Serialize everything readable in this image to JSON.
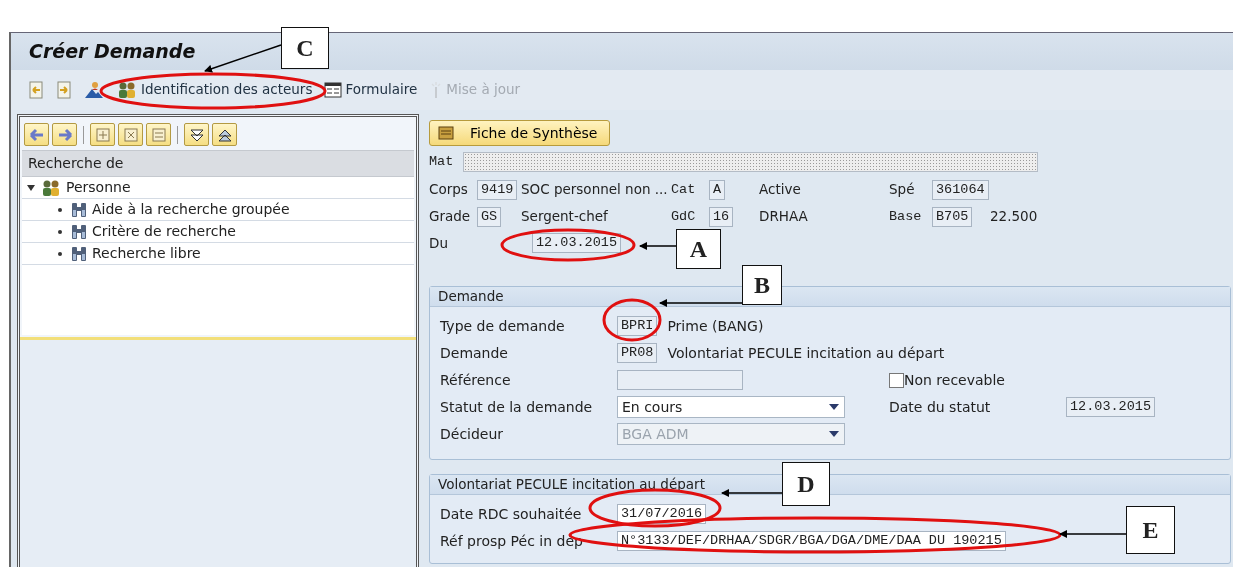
{
  "window": {
    "title": "Créer Demande"
  },
  "toolbar": [
    {
      "kind": "icon",
      "disabled": false
    },
    {
      "kind": "icon",
      "disabled": false
    },
    {
      "kind": "icon",
      "disabled": false
    },
    {
      "kind": "text",
      "label": "Identification des acteurs",
      "disabled": false
    },
    {
      "kind": "text",
      "label": "Formulaire",
      "disabled": false
    },
    {
      "kind": "text",
      "label": "Mise à jour",
      "disabled": true
    }
  ],
  "navigator": {
    "header": "Recherche de",
    "tree": [
      {
        "label": "Personne",
        "expanded": true,
        "children": [
          {
            "label": "Aide à la recherche groupée"
          },
          {
            "label": "Critère de recherche"
          },
          {
            "label": "Recherche libre"
          }
        ]
      }
    ]
  },
  "summary_button": "Fiche de Synthèse",
  "mat": {
    "label": "Mat"
  },
  "identity_rows": [
    [
      {
        "kind": "label",
        "text": "Corps"
      },
      {
        "kind": "field",
        "text": "9419"
      },
      {
        "kind": "text",
        "text": "SOC personnel non ..."
      },
      {
        "kind": "code",
        "text": "Cat"
      },
      {
        "kind": "field",
        "text": "A"
      },
      {
        "kind": "text",
        "text": "Active"
      },
      {
        "kind": "label",
        "text": "Spé"
      },
      {
        "kind": "field",
        "text": "361064"
      }
    ],
    [
      {
        "kind": "label",
        "text": "Grade"
      },
      {
        "kind": "field",
        "text": "GS"
      },
      {
        "kind": "text",
        "text": "Sergent-chef"
      },
      {
        "kind": "code",
        "text": "GdC"
      },
      {
        "kind": "field",
        "text": "16"
      },
      {
        "kind": "text",
        "text": "DRHAA"
      },
      {
        "kind": "code",
        "text": "Base"
      },
      {
        "kind": "field",
        "text": "B705"
      },
      {
        "kind": "text",
        "text": "22.500"
      }
    ]
  ],
  "du": {
    "label": "Du",
    "value": "12.03.2015"
  },
  "groups": [
    {
      "title": "Demande",
      "rows": [
        {
          "label": "Type de demande",
          "field": {
            "kind": "input",
            "value": "BPRI"
          },
          "description": "Prime (BANG)"
        },
        {
          "label": "Demande",
          "field": {
            "kind": "input",
            "value": "PR08"
          },
          "description": "Volontariat PECULE incitation au départ"
        },
        {
          "label": "Référence",
          "field": {
            "kind": "input"
          },
          "side": {
            "kind": "checkbox",
            "label": "Non recevable",
            "checked": false
          }
        },
        {
          "label": "Statut de la demande",
          "field": {
            "kind": "dropdown",
            "value": "En cours",
            "disabled": false
          },
          "side": {
            "kind": "field",
            "label": "Date du statut",
            "value": "12.03.2015"
          }
        },
        {
          "label": "Décideur",
          "field": {
            "kind": "dropdown",
            "value": "BGA ADM",
            "disabled": true
          }
        }
      ]
    },
    {
      "title": "Volontariat PECULE incitation au départ",
      "rows": [
        {
          "label": "Date RDC souhaitée",
          "field": {
            "kind": "input",
            "value": "31/07/2016"
          }
        },
        {
          "label": "Réf prosp Péc in dép",
          "field": {
            "kind": "input",
            "value": "N°3133/DEF/DRHAA/SDGR/BGA/DGA/DME/DAA DU 190215"
          }
        }
      ]
    }
  ],
  "annotations": [
    {
      "label": "C"
    },
    {
      "label": "A"
    },
    {
      "label": "B"
    },
    {
      "label": "D"
    },
    {
      "label": "E"
    }
  ]
}
